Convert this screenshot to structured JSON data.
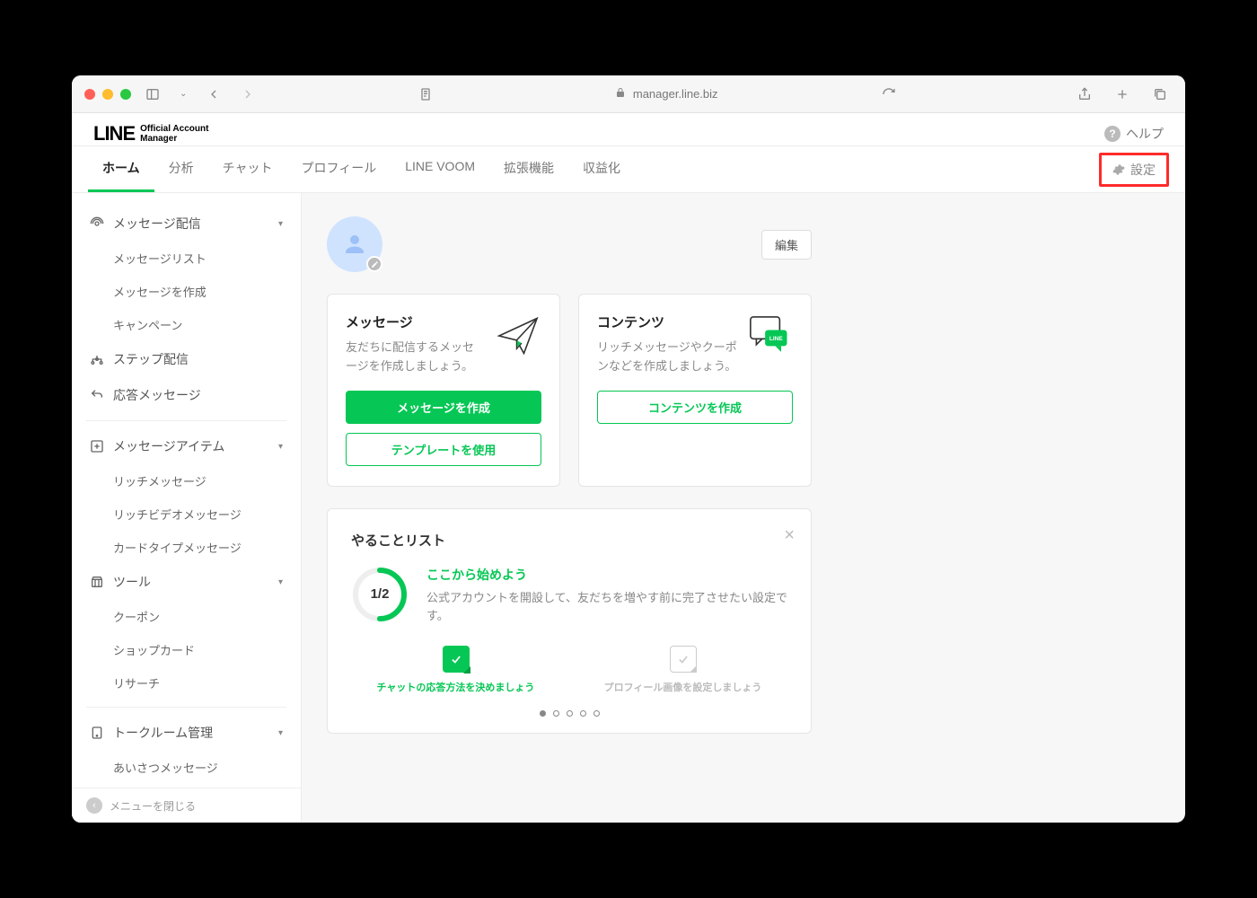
{
  "browser": {
    "url": "manager.line.biz"
  },
  "header": {
    "brand_main": "LINE",
    "brand_sub1": "Official Account",
    "brand_sub2": "Manager",
    "help": "ヘルプ"
  },
  "nav": {
    "items": [
      "ホーム",
      "分析",
      "チャット",
      "プロフィール",
      "LINE VOOM",
      "拡張機能",
      "収益化"
    ],
    "settings": "設定"
  },
  "sidebar": {
    "groups": [
      {
        "title": "メッセージ配信",
        "expandable": true,
        "children": [
          "メッセージリスト",
          "メッセージを作成",
          "キャンペーン"
        ]
      }
    ],
    "singles": [
      {
        "label": "ステップ配信"
      },
      {
        "label": "応答メッセージ"
      }
    ],
    "groups2": [
      {
        "title": "メッセージアイテム",
        "expandable": true,
        "children": [
          "リッチメッセージ",
          "リッチビデオメッセージ",
          "カードタイプメッセージ"
        ]
      },
      {
        "title": "ツール",
        "expandable": true,
        "children": [
          "クーポン",
          "ショップカード",
          "リサーチ"
        ]
      },
      {
        "title": "トークルーム管理",
        "expandable": true,
        "children": [
          "あいさつメッセージ"
        ]
      }
    ],
    "collapse_label": "メニューを閉じる"
  },
  "profile": {
    "edit": "編集"
  },
  "cards": {
    "message": {
      "title": "メッセージ",
      "desc": "友だちに配信するメッセージを作成しましょう。",
      "primary": "メッセージを作成",
      "outline": "テンプレートを使用"
    },
    "contents": {
      "title": "コンテンツ",
      "desc": "リッチメッセージやクーポンなどを作成しましょう。",
      "outline": "コンテンツを作成",
      "badge": "LINE"
    }
  },
  "todo": {
    "heading": "やることリスト",
    "progress_label": "1/2",
    "progress_ratio": 0.5,
    "start_title": "ここから始めよう",
    "start_desc": "公式アカウントを開設して、友だちを増やす前に完了させたい設定です。",
    "step_done": "チャットの応答方法を決めましょう",
    "step_pending": "プロフィール画像を設定しましょう",
    "dot_count": 5,
    "dot_active": 0
  }
}
